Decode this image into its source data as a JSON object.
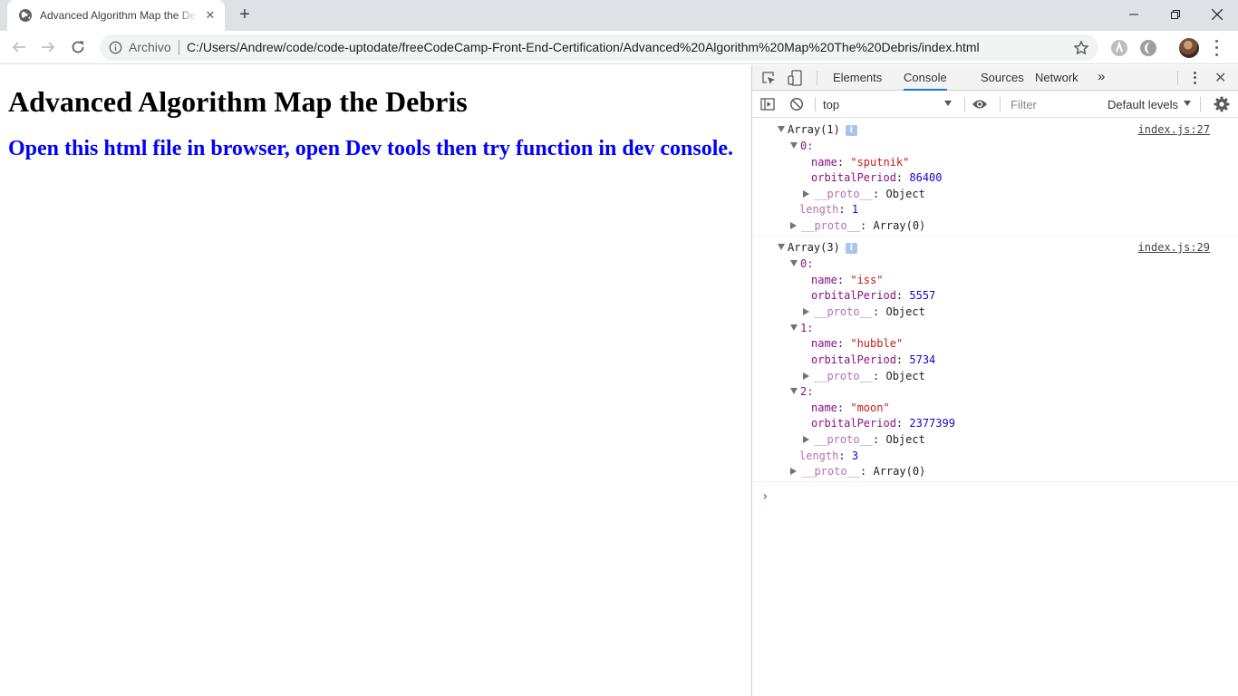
{
  "tab": {
    "title": "Advanced Algorithm Map the Debris"
  },
  "toolbar": {
    "scheme_label": "Archivo",
    "url": "C:/Users/Andrew/code/code-uptodate/freeCodeCamp-Front-End-Certification/Advanced%20Algorithm%20Map%20The%20Debris/index.html"
  },
  "page": {
    "heading": "Advanced Algorithm Map the Debris",
    "subheading": "Open this html file in browser, open Dev tools then try function in dev console."
  },
  "devtools": {
    "tabs": [
      "Elements",
      "Console",
      "Sources",
      "Network"
    ],
    "active_tab": "Console",
    "context": "top",
    "filter_placeholder": "Filter",
    "levels": "Default levels",
    "messages": [
      {
        "summary": "Array(1)",
        "source": "index.js:27",
        "items": [
          {
            "index": "0:",
            "name": "\"sputnik\"",
            "orbitalPeriod": "86400",
            "proto": "Object"
          }
        ],
        "length": "1",
        "proto": "Array(0)"
      },
      {
        "summary": "Array(3)",
        "source": "index.js:29",
        "items": [
          {
            "index": "0:",
            "name": "\"iss\"",
            "orbitalPeriod": "5557",
            "proto": "Object"
          },
          {
            "index": "1:",
            "name": "\"hubble\"",
            "orbitalPeriod": "5734",
            "proto": "Object"
          },
          {
            "index": "2:",
            "name": "\"moon\"",
            "orbitalPeriod": "2377399",
            "proto": "Object"
          }
        ],
        "length": "3",
        "proto": "Array(0)"
      }
    ],
    "keys": {
      "name": "name",
      "orbitalPeriod": "orbitalPeriod",
      "proto": "__proto__",
      "length": "length",
      "info": "i",
      "prompt": "›"
    }
  }
}
